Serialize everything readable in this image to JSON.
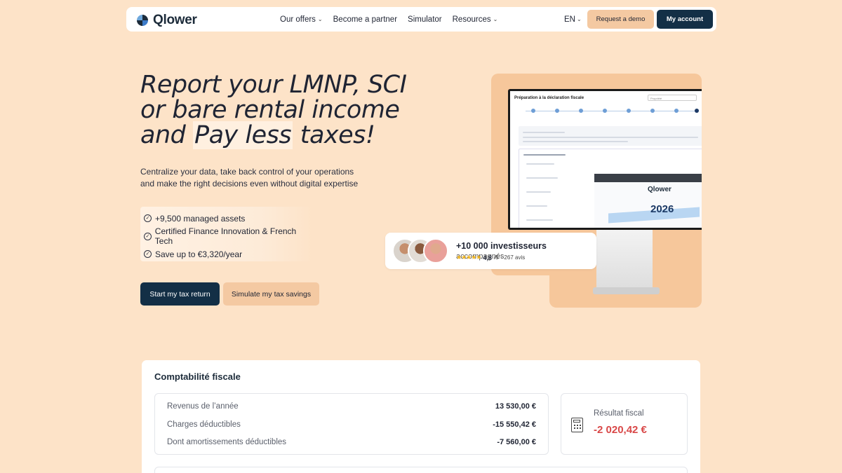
{
  "nav": {
    "brand": "Qlower",
    "links": [
      {
        "label": "Our offers",
        "dropdown": true
      },
      {
        "label": "Become a partner",
        "dropdown": false
      },
      {
        "label": "Simulator",
        "dropdown": false
      },
      {
        "label": "Resources",
        "dropdown": true
      }
    ],
    "language": "EN",
    "demo_label": "Request a demo",
    "account_label": "My account"
  },
  "hero": {
    "headline_1": "Report your LMNP, SCI",
    "headline_2": "or bare rental income",
    "headline_3a": "and",
    "headline_3b": "Pay less",
    "headline_3c": "taxes!",
    "subtitle": "Centralize your data, take back control of your operations and make the right decisions even without digital expertise",
    "features": [
      "+9,500 managed assets",
      "Certified Finance Innovation & French Tech",
      "Save up to €3,320/year"
    ],
    "cta_primary": "Start my tax return",
    "cta_secondary": "Simulate my tax savings"
  },
  "illustration": {
    "screen_title": "Préparation à la déclaration fiscale",
    "screen_property": "Propriété",
    "doc_brand": "Qlower",
    "doc_year": "2026",
    "investors_count": "+10 000 investisseurs",
    "investors_suffix": "accompagnés",
    "rating": "4,8",
    "rating_scale": "/5",
    "reviews": "· 267 avis"
  },
  "accounting": {
    "title": "Comptabilité fiscale",
    "rows": [
      {
        "label": "Revenus de l’année",
        "value": "13 530,00 €"
      },
      {
        "label": "Charges déductibles",
        "value": "-15 550,42 €"
      },
      {
        "label": "Dont amortissements déductibles",
        "value": "-7 560,00 €"
      }
    ],
    "result_label": "Résultat fiscal",
    "result_value": "-2 020,42 €"
  },
  "colors": {
    "background": "#fde3c8",
    "navy": "#132f46",
    "peach_button": "#f4c9a2",
    "negative": "#d94848"
  }
}
